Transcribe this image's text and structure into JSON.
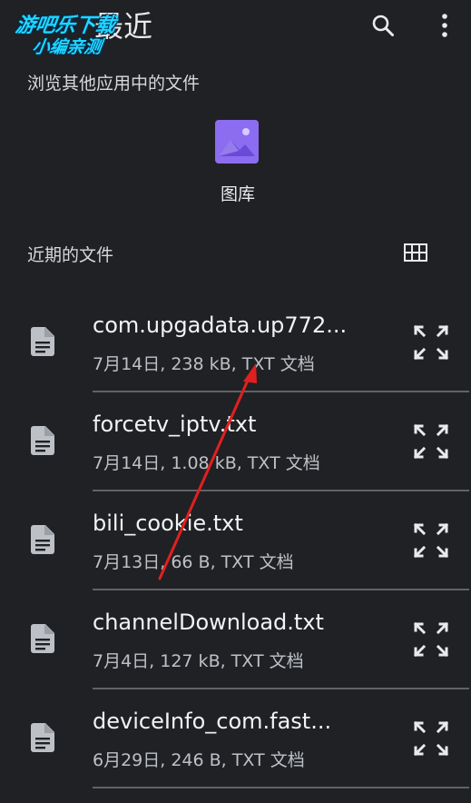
{
  "header": {
    "title": "最近"
  },
  "watermark": {
    "line1": "游吧乐下载",
    "line2": "小编亲测"
  },
  "subtitle": "浏览其他应用中的文件",
  "gallery": {
    "label": "图库"
  },
  "recent": {
    "title": "近期的文件",
    "files": [
      {
        "name": "com.upgadata.up772...",
        "meta": "7月14日, 238 kB, TXT 文档"
      },
      {
        "name": "forcetv_iptv.txt",
        "meta": "7月14日, 1.08 kB, TXT 文档"
      },
      {
        "name": "bili_cookie.txt",
        "meta": "7月13日, 66 B, TXT 文档"
      },
      {
        "name": "channelDownload.txt",
        "meta": "7月4日, 127 kB, TXT 文档"
      },
      {
        "name": "deviceInfo_com.fast...",
        "meta": "6月29日, 246 B, TXT 文档"
      }
    ]
  },
  "colors": {
    "background": "#202124",
    "gallery_icon": "#8c6cf0",
    "annotation_arrow": "#e02020",
    "watermark": "#1fd6ff"
  }
}
